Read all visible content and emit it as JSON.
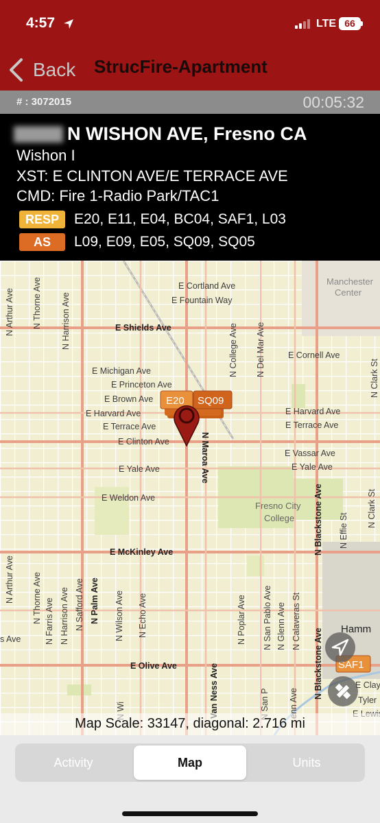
{
  "status_bar": {
    "time": "4:57",
    "carrier": "LTE",
    "battery": "66"
  },
  "nav": {
    "back_label": "Back",
    "title": "StrucFire-Apartment"
  },
  "incident": {
    "number": "# : 3072015",
    "elapsed": "00:05:32"
  },
  "details": {
    "address": "N WISHON AVE, Fresno CA",
    "location": "Wishon I",
    "cross_streets": "XST: E CLINTON AVE/E TERRACE AVE",
    "command": "CMD: Fire 1-Radio Park/TAC1",
    "responding": {
      "label": "RESP",
      "units": "E20, E11, E04, BC04, SAF1, L03"
    },
    "assigned": {
      "label": "AS",
      "units": "L09, E09, E05, SQ09, SQ05"
    }
  },
  "map": {
    "streets": {
      "cortland": "E Cortland Ave",
      "fountain": "E Fountain Way",
      "shields": "E Shields Ave",
      "cornell": "E Cornell Ave",
      "michigan": "E Michigan Ave",
      "princeton": "E Princeton Ave",
      "brown": "E Brown Ave",
      "harvard_w": "E Harvard Ave",
      "terrace_w": "E Terrace Ave",
      "clinton": "E Clinton Ave",
      "harvard_e": "E Harvard Ave",
      "terrace_e": "E Terrace Ave",
      "vassar": "E Vassar Ave",
      "yale_w": "E Yale Ave",
      "yale_e": "E Yale Ave",
      "weldon": "E Weldon Ave",
      "mckinley": "E McKinley Ave",
      "olive": "E Olive Ave",
      "clay": "E Clay",
      "tyler": "Tyler",
      "lewis": "E Lewis",
      "arthur_top": "N Arthur Ave",
      "thorne_top": "N Thorne Ave",
      "harrison_top": "N Harrison Ave",
      "college": "N College Ave",
      "delmar": "N Del Mar Ave",
      "clark_top": "N Clark St",
      "maroa": "N Maroa Ave",
      "blackstone_top": "N Blackstone Ave",
      "effie": "N Effie St",
      "clark_mid": "N Clark St",
      "arthur_bot": "N Arthur Ave",
      "thorne_bot": "N Thorne Ave",
      "farris": "N Farris Ave",
      "harrison_bot": "N Harrison Ave",
      "safford": "N Safford Ave",
      "palm": "N Palm Ave",
      "wilson": "N Wilson Ave",
      "echo": "N Echo Ave",
      "vanness": "Van Ness Ave",
      "poplar": "N Poplar Ave",
      "sanpablo": "N San Pablo Ave",
      "glenn": "N Glenn Ave",
      "calaveras": "N Calaveras St",
      "blackstone_bot": "N Blackstone Ave",
      "sanp_bot": "N San P",
      "glenn_bot": "enn Ave",
      "wi_bot": "N Wi",
      "s_ave": "s Ave",
      "hamm": "Hamm"
    },
    "places": {
      "manchester": "Manchester",
      "manchester2": "Center",
      "fcc": "Fresno City",
      "fcc2": "College"
    },
    "unit_markers": {
      "e20": "E20",
      "sq09": "SQ09",
      "saf1": "SAF1"
    },
    "scale_text": "Map Scale: 33147, diagonal: 2.716 mi"
  },
  "tabs": {
    "activity": "Activity",
    "map": "Map",
    "units": "Units"
  },
  "colors": {
    "header": "#9c1414",
    "resp": "#f0b33a",
    "as": "#dc6b24",
    "map_bg": "#f1eed2",
    "arterial": "#e8a088"
  }
}
